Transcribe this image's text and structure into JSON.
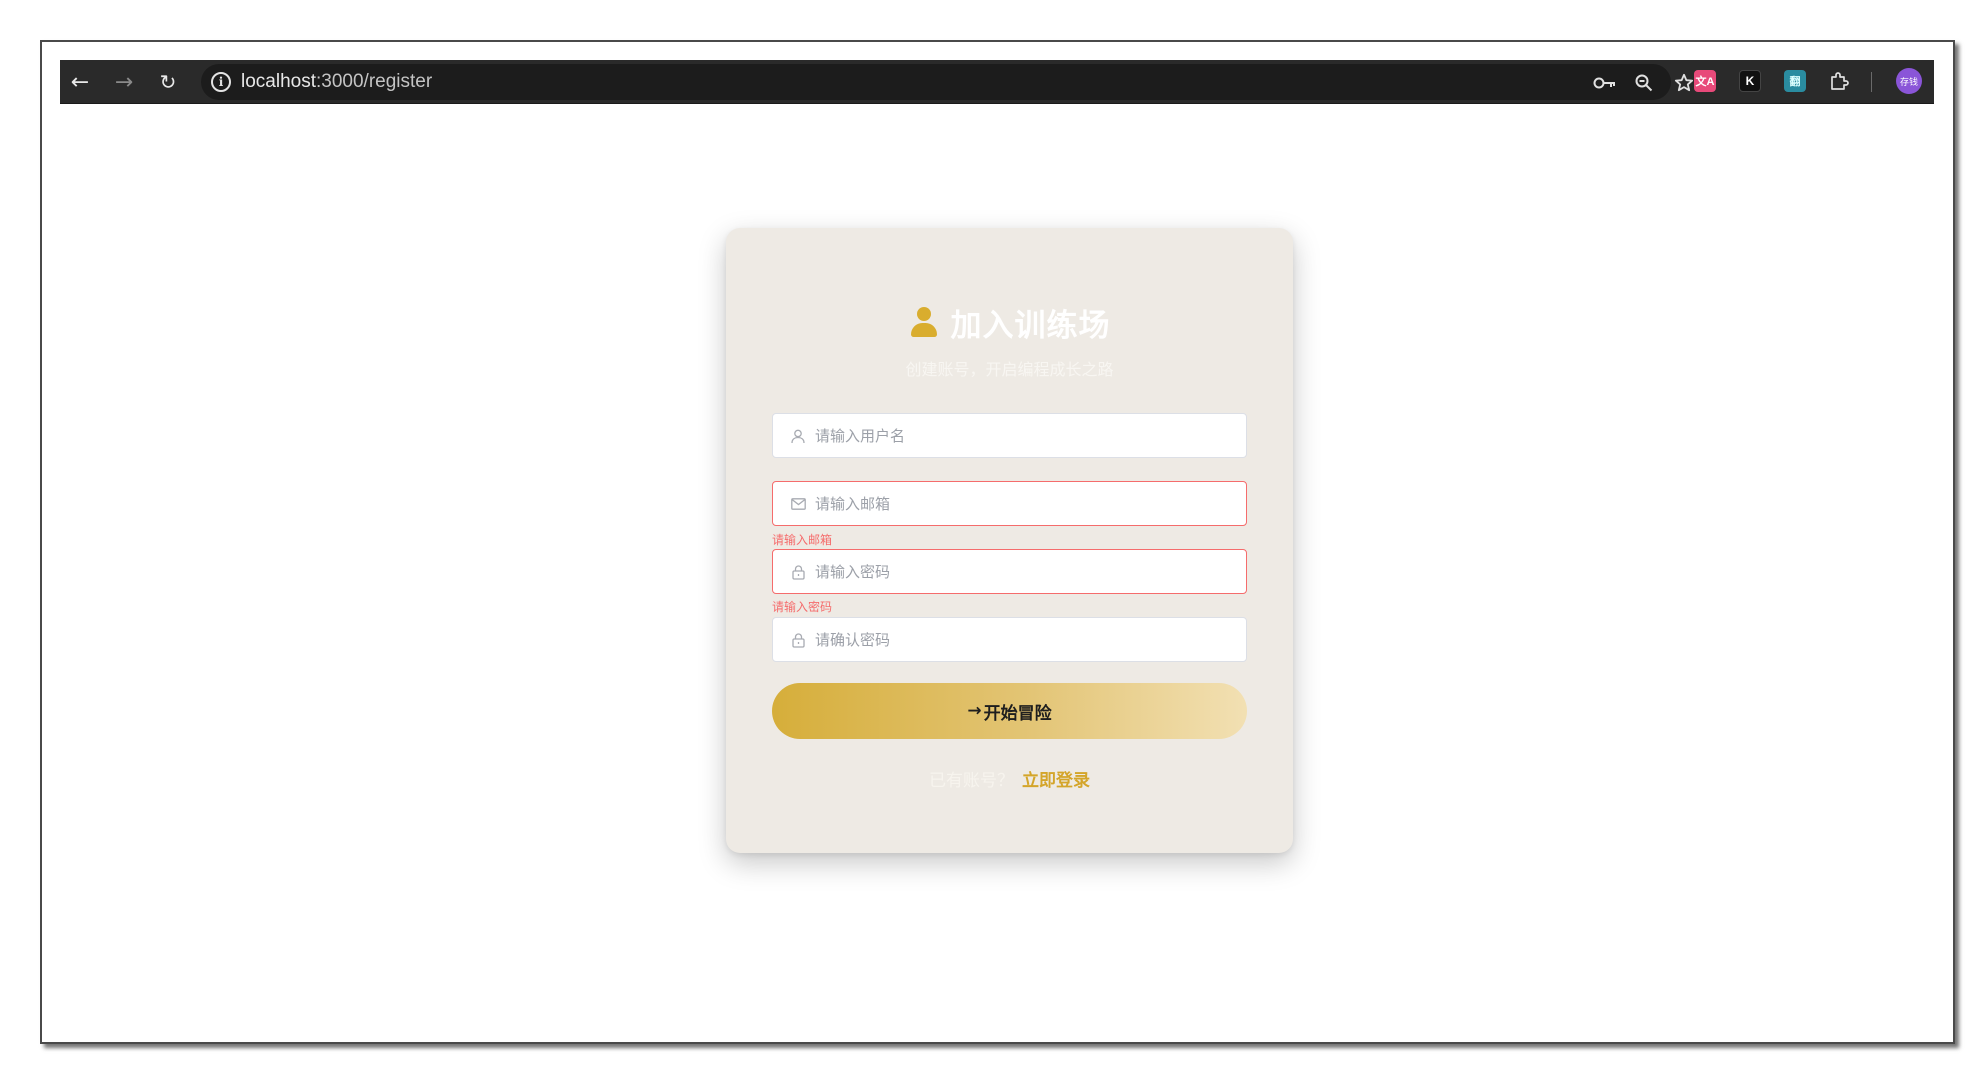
{
  "browser": {
    "url_host": "localhost",
    "url_path": ":3000/register",
    "extensions": {
      "translate_label": "文A",
      "k_label": "K",
      "grid_label": "翻",
      "profile_label": "存钱"
    }
  },
  "register": {
    "title": "加入训练场",
    "subtitle": "创建账号，开启编程成长之路",
    "username_placeholder": "请输入用户名",
    "email_placeholder": "请输入邮箱",
    "email_error": "请输入邮箱",
    "password_placeholder": "请输入密码",
    "password_error": "请输入密码",
    "confirm_placeholder": "请确认密码",
    "submit_arrow": "→",
    "submit_label": "开始冒险",
    "has_account_text": "已有账号？",
    "login_link": "立即登录"
  },
  "colors": {
    "accent_gold": "#d9ad2e",
    "error_red": "#f56c6c",
    "card_bg": "#eeeae4"
  }
}
